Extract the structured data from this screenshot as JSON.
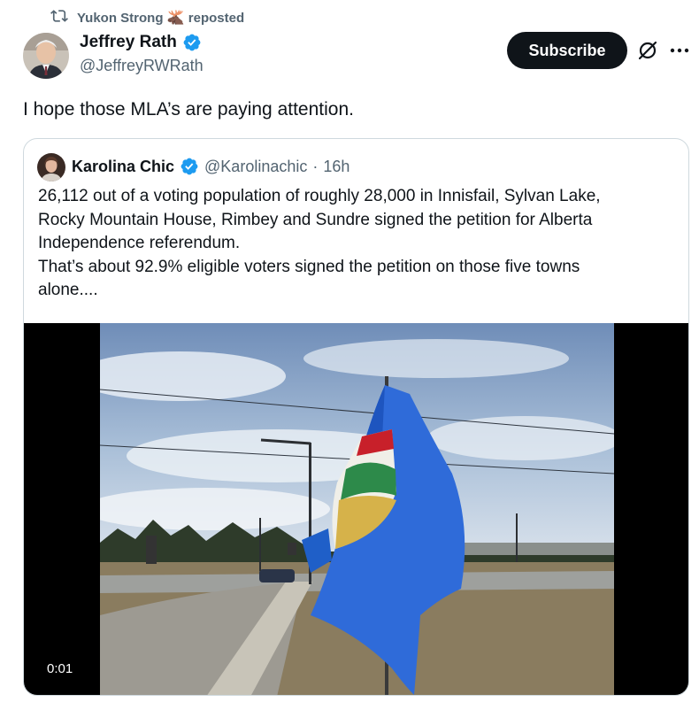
{
  "repost": {
    "reposter": "Yukon Strong",
    "emoji": "🫎",
    "suffix": "reposted"
  },
  "author": {
    "name": "Jeffrey Rath",
    "handle": "@JeffreyRWRath",
    "verified": true
  },
  "actions": {
    "subscribe_label": "Subscribe",
    "grok_icon": "slashed-circle-icon",
    "more_icon": "more-dots-icon"
  },
  "tweet": {
    "text": "I hope those MLA’s are paying attention."
  },
  "quote": {
    "name": "Karolina Chic",
    "handle": "@Karolinachic",
    "separator": "·",
    "time": "16h",
    "verified": true,
    "lines": [
      "26,112 out of a voting population of roughly 28,000 in Innisfail, Sylvan Lake,",
      "Rocky Mountain House, Rimbey and Sundre signed the petition for Alberta",
      "Independence referendum.",
      "That’s about 92.9% eligible voters signed the petition on those five towns",
      "alone...."
    ],
    "media": {
      "duration": "0:01",
      "description_icon": "video-thumbnail"
    }
  },
  "colors": {
    "accent": "#1d9bf0",
    "text": "#0f1419",
    "muted": "#536471",
    "border": "#cfd9de"
  }
}
